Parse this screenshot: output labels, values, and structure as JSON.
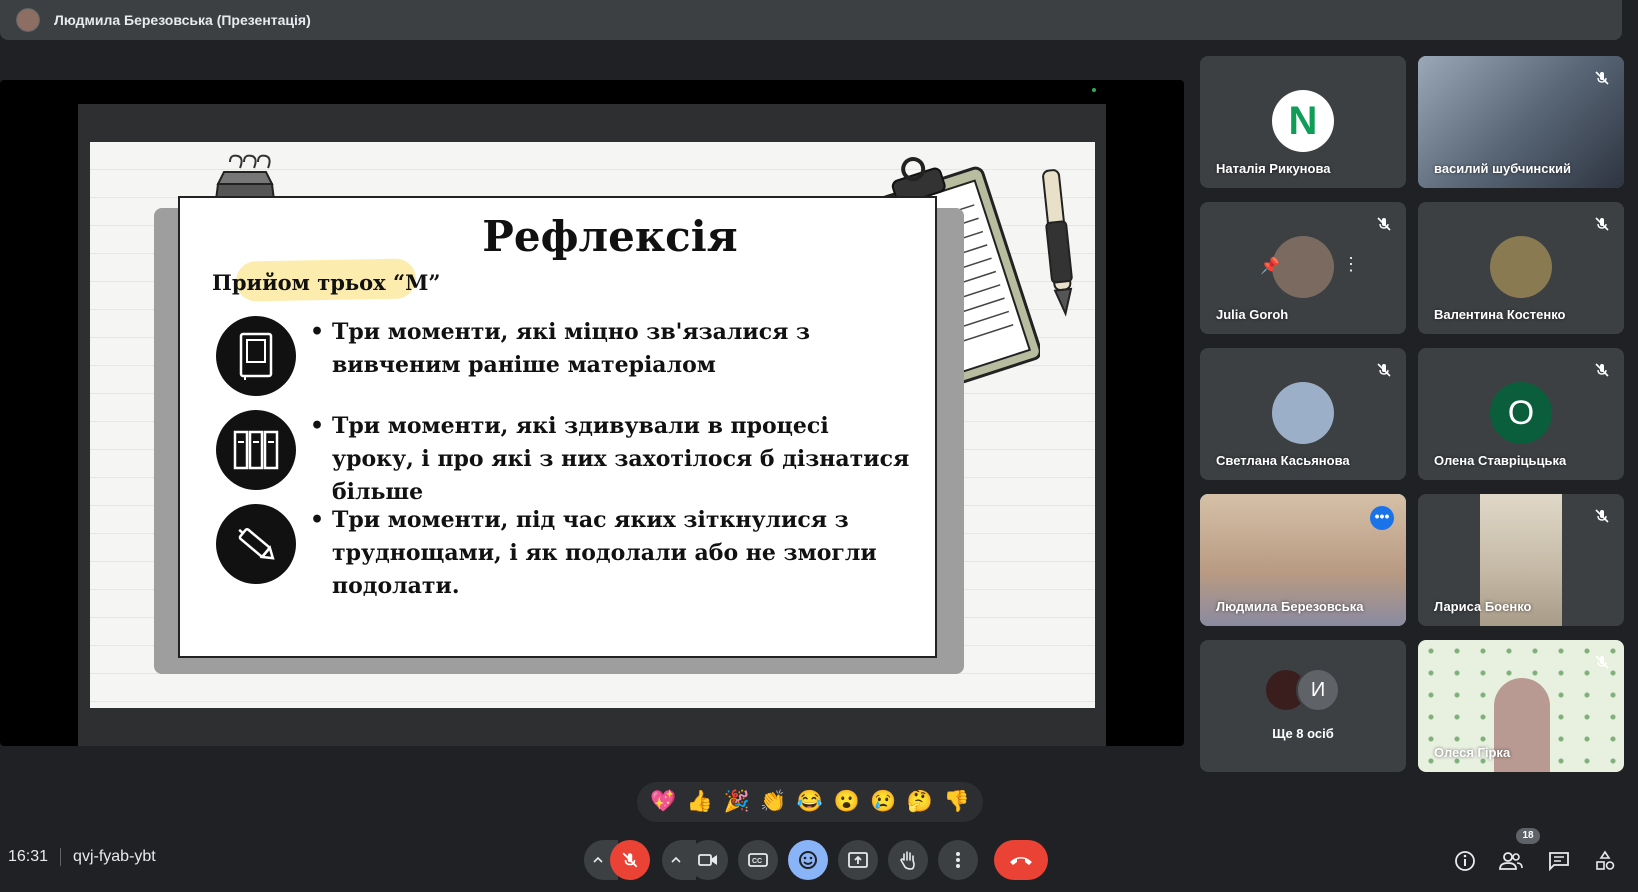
{
  "header": {
    "presenter_title": "Людмила Березовська (Презентація)"
  },
  "slide": {
    "title": "Рефлексія",
    "subtitle": "Прийом трьох “М”",
    "items": [
      {
        "bullet": "•",
        "text": "Три моменти, які міцно зв'язалися з вивченим раніше матеріалом"
      },
      {
        "bullet": "•",
        "text": "Три моменти, які здивували в процесі уроку, і про які з них захотілося б дізнатися більше"
      },
      {
        "bullet": "•",
        "text": "Три моменти, під час яких зіткнулися з труднощами, і як подолали або не змогли подолати."
      }
    ]
  },
  "participants": [
    {
      "name": "Наталія Рикунова",
      "avatar_letter": "N",
      "avatar_color": "#ffffff",
      "muted": false
    },
    {
      "name": "василий шубчинский",
      "avatar_letter": "",
      "avatar_color": "#6d7a8a",
      "muted": true
    },
    {
      "name": "Julia Goroh",
      "avatar_letter": "",
      "avatar_color": "#7a6a60",
      "muted": true
    },
    {
      "name": "Валентина Костенко",
      "avatar_letter": "",
      "avatar_color": "#8a7a52",
      "muted": true
    },
    {
      "name": "Светлана Касьянова",
      "avatar_letter": "",
      "avatar_color": "#9bb0c8",
      "muted": true
    },
    {
      "name": "Олена Ставріцьцька",
      "avatar_letter": "О",
      "avatar_color": "#0b5e3c",
      "muted": true
    },
    {
      "name": "Людмила Березовська",
      "avatar_letter": "",
      "avatar_color": "#b89a82",
      "muted": false
    },
    {
      "name": "Лариса Боенко",
      "avatar_letter": "",
      "avatar_color": "#c4b8a4",
      "muted": true
    },
    {
      "name": "Олеся Гірка",
      "avatar_letter": "",
      "avatar_color": "#e8f0e0",
      "muted": true
    }
  ],
  "others": {
    "label": "Ще 8 осіб",
    "avatar_letter": "И"
  },
  "reactions": [
    "💖",
    "👍",
    "🎉",
    "👏",
    "😂",
    "😮",
    "😢",
    "🤔",
    "👎"
  ],
  "meeting": {
    "time": "16:31",
    "code": "qvj-fyab-ybt",
    "participant_count": "18"
  },
  "colors": {
    "accent": "#8ab4f8",
    "danger": "#ea4335",
    "surface": "#3c4043",
    "background": "#202124"
  }
}
